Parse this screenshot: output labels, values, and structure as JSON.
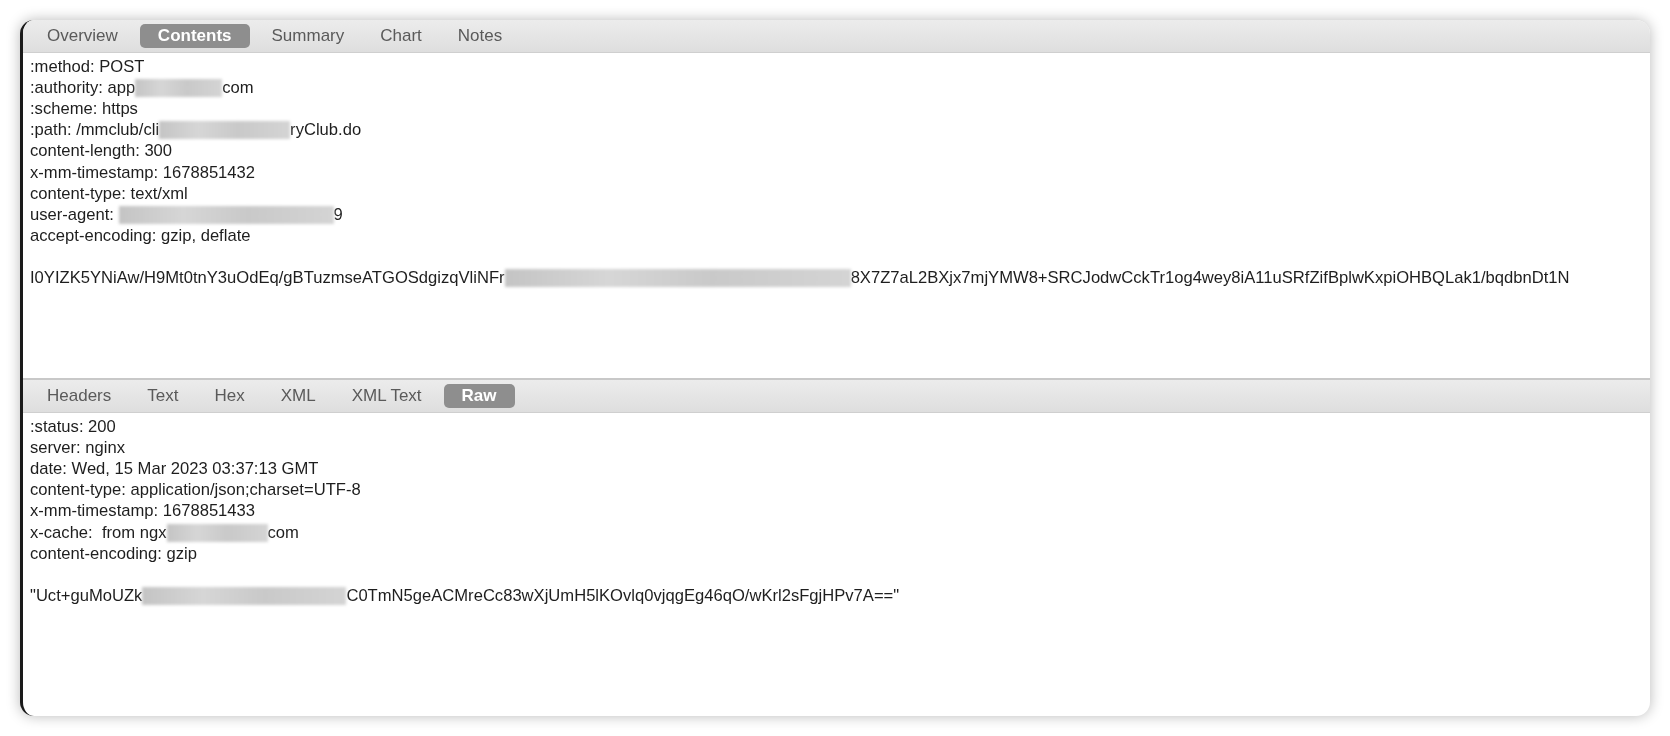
{
  "request": {
    "tabs": [
      {
        "label": "Overview",
        "selected": false
      },
      {
        "label": "Contents",
        "selected": true
      },
      {
        "label": "Summary",
        "selected": false
      },
      {
        "label": "Chart",
        "selected": false
      },
      {
        "label": "Notes",
        "selected": false
      }
    ],
    "lines": [
      [
        {
          "kind": "text",
          "text": ":method: POST"
        }
      ],
      [
        {
          "kind": "text",
          "text": ":authority: app"
        },
        {
          "kind": "redacted"
        },
        {
          "kind": "text",
          "text": "com"
        }
      ],
      [
        {
          "kind": "text",
          "text": ":scheme: https"
        }
      ],
      [
        {
          "kind": "text",
          "text": ":path: /mmclub/cli"
        },
        {
          "kind": "redacted"
        },
        {
          "kind": "text",
          "text": "ryClub.do"
        }
      ],
      [
        {
          "kind": "text",
          "text": "content-length: 300"
        }
      ],
      [
        {
          "kind": "text",
          "text": "x-mm-timestamp: 1678851432"
        }
      ],
      [
        {
          "kind": "text",
          "text": "content-type: text/xml"
        }
      ],
      [
        {
          "kind": "text",
          "text": "user-agent: "
        },
        {
          "kind": "redacted"
        },
        {
          "kind": "text",
          "text": "9"
        }
      ],
      [
        {
          "kind": "text",
          "text": "accept-encoding: gzip, deflate"
        }
      ],
      [
        {
          "kind": "blank"
        }
      ],
      [
        {
          "kind": "text",
          "text": "I0YIZK5YNiAw/H9Mt0tnY3uOdEq/gBTuzmseATGOSdgizqVliNFr"
        },
        {
          "kind": "redacted"
        },
        {
          "kind": "text",
          "text": "8X7Z7aL2BXjx7mjYMW8+SRCJodwCckTr1og4wey8iA11uSRfZifBplwKxpiOHBQLak1/bqdbnDt1N"
        }
      ]
    ]
  },
  "response": {
    "tabs": [
      {
        "label": "Headers",
        "selected": false
      },
      {
        "label": "Text",
        "selected": false
      },
      {
        "label": "Hex",
        "selected": false
      },
      {
        "label": "XML",
        "selected": false
      },
      {
        "label": "XML Text",
        "selected": false
      },
      {
        "label": "Raw",
        "selected": true
      }
    ],
    "lines": [
      [
        {
          "kind": "text",
          "text": ":status: 200"
        }
      ],
      [
        {
          "kind": "text",
          "text": "server: nginx"
        }
      ],
      [
        {
          "kind": "text",
          "text": "date: Wed, 15 Mar 2023 03:37:13 GMT"
        }
      ],
      [
        {
          "kind": "text",
          "text": "content-type: application/json;charset=UTF-8"
        }
      ],
      [
        {
          "kind": "text",
          "text": "x-mm-timestamp: 1678851433"
        }
      ],
      [
        {
          "kind": "text",
          "text": "x-cache:  from ngx"
        },
        {
          "kind": "redacted"
        },
        {
          "kind": "text",
          "text": "com"
        }
      ],
      [
        {
          "kind": "text",
          "text": "content-encoding: gzip"
        }
      ],
      [
        {
          "kind": "blank"
        }
      ],
      [
        {
          "kind": "text",
          "text": "\"Uct+guMoUZk"
        },
        {
          "kind": "redacted"
        },
        {
          "kind": "text",
          "text": "C0TmN5geACMreCc83wXjUmH5lKOvlq0vjqgEg46qO/wKrl2sFgjHPv7A==\""
        }
      ]
    ]
  }
}
